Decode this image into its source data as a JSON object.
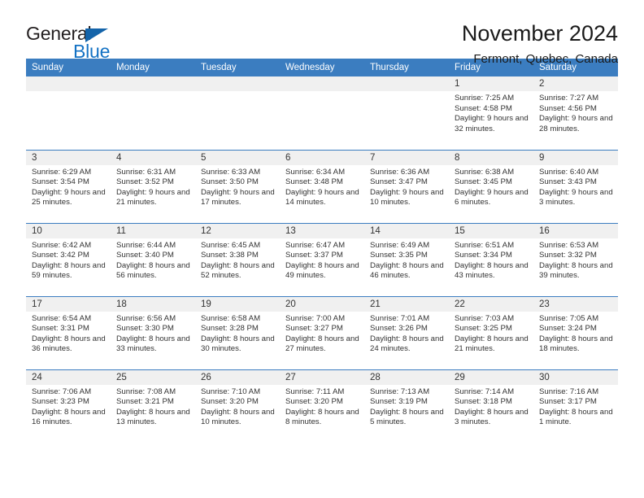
{
  "brand": {
    "word_one": "General",
    "word_two": "Blue",
    "triangle_icon": "triangle-icon",
    "accent_color": "#1472c4"
  },
  "header": {
    "title": "November 2024",
    "subtitle": "Fermont, Quebec, Canada"
  },
  "calendar": {
    "header_bg": "#3b7dc0",
    "daynum_bg": "#f0f0f0",
    "weekdays": [
      "Sunday",
      "Monday",
      "Tuesday",
      "Wednesday",
      "Thursday",
      "Friday",
      "Saturday"
    ],
    "weeks": [
      [
        {
          "day": "",
          "empty": true
        },
        {
          "day": "",
          "empty": true
        },
        {
          "day": "",
          "empty": true
        },
        {
          "day": "",
          "empty": true
        },
        {
          "day": "",
          "empty": true
        },
        {
          "day": "1",
          "sunrise": "Sunrise: 7:25 AM",
          "sunset": "Sunset: 4:58 PM",
          "daylight": "Daylight: 9 hours and 32 minutes."
        },
        {
          "day": "2",
          "sunrise": "Sunrise: 7:27 AM",
          "sunset": "Sunset: 4:56 PM",
          "daylight": "Daylight: 9 hours and 28 minutes."
        }
      ],
      [
        {
          "day": "3",
          "sunrise": "Sunrise: 6:29 AM",
          "sunset": "Sunset: 3:54 PM",
          "daylight": "Daylight: 9 hours and 25 minutes."
        },
        {
          "day": "4",
          "sunrise": "Sunrise: 6:31 AM",
          "sunset": "Sunset: 3:52 PM",
          "daylight": "Daylight: 9 hours and 21 minutes."
        },
        {
          "day": "5",
          "sunrise": "Sunrise: 6:33 AM",
          "sunset": "Sunset: 3:50 PM",
          "daylight": "Daylight: 9 hours and 17 minutes."
        },
        {
          "day": "6",
          "sunrise": "Sunrise: 6:34 AM",
          "sunset": "Sunset: 3:48 PM",
          "daylight": "Daylight: 9 hours and 14 minutes."
        },
        {
          "day": "7",
          "sunrise": "Sunrise: 6:36 AM",
          "sunset": "Sunset: 3:47 PM",
          "daylight": "Daylight: 9 hours and 10 minutes."
        },
        {
          "day": "8",
          "sunrise": "Sunrise: 6:38 AM",
          "sunset": "Sunset: 3:45 PM",
          "daylight": "Daylight: 9 hours and 6 minutes."
        },
        {
          "day": "9",
          "sunrise": "Sunrise: 6:40 AM",
          "sunset": "Sunset: 3:43 PM",
          "daylight": "Daylight: 9 hours and 3 minutes."
        }
      ],
      [
        {
          "day": "10",
          "sunrise": "Sunrise: 6:42 AM",
          "sunset": "Sunset: 3:42 PM",
          "daylight": "Daylight: 8 hours and 59 minutes."
        },
        {
          "day": "11",
          "sunrise": "Sunrise: 6:44 AM",
          "sunset": "Sunset: 3:40 PM",
          "daylight": "Daylight: 8 hours and 56 minutes."
        },
        {
          "day": "12",
          "sunrise": "Sunrise: 6:45 AM",
          "sunset": "Sunset: 3:38 PM",
          "daylight": "Daylight: 8 hours and 52 minutes."
        },
        {
          "day": "13",
          "sunrise": "Sunrise: 6:47 AM",
          "sunset": "Sunset: 3:37 PM",
          "daylight": "Daylight: 8 hours and 49 minutes."
        },
        {
          "day": "14",
          "sunrise": "Sunrise: 6:49 AM",
          "sunset": "Sunset: 3:35 PM",
          "daylight": "Daylight: 8 hours and 46 minutes."
        },
        {
          "day": "15",
          "sunrise": "Sunrise: 6:51 AM",
          "sunset": "Sunset: 3:34 PM",
          "daylight": "Daylight: 8 hours and 43 minutes."
        },
        {
          "day": "16",
          "sunrise": "Sunrise: 6:53 AM",
          "sunset": "Sunset: 3:32 PM",
          "daylight": "Daylight: 8 hours and 39 minutes."
        }
      ],
      [
        {
          "day": "17",
          "sunrise": "Sunrise: 6:54 AM",
          "sunset": "Sunset: 3:31 PM",
          "daylight": "Daylight: 8 hours and 36 minutes."
        },
        {
          "day": "18",
          "sunrise": "Sunrise: 6:56 AM",
          "sunset": "Sunset: 3:30 PM",
          "daylight": "Daylight: 8 hours and 33 minutes."
        },
        {
          "day": "19",
          "sunrise": "Sunrise: 6:58 AM",
          "sunset": "Sunset: 3:28 PM",
          "daylight": "Daylight: 8 hours and 30 minutes."
        },
        {
          "day": "20",
          "sunrise": "Sunrise: 7:00 AM",
          "sunset": "Sunset: 3:27 PM",
          "daylight": "Daylight: 8 hours and 27 minutes."
        },
        {
          "day": "21",
          "sunrise": "Sunrise: 7:01 AM",
          "sunset": "Sunset: 3:26 PM",
          "daylight": "Daylight: 8 hours and 24 minutes."
        },
        {
          "day": "22",
          "sunrise": "Sunrise: 7:03 AM",
          "sunset": "Sunset: 3:25 PM",
          "daylight": "Daylight: 8 hours and 21 minutes."
        },
        {
          "day": "23",
          "sunrise": "Sunrise: 7:05 AM",
          "sunset": "Sunset: 3:24 PM",
          "daylight": "Daylight: 8 hours and 18 minutes."
        }
      ],
      [
        {
          "day": "24",
          "sunrise": "Sunrise: 7:06 AM",
          "sunset": "Sunset: 3:23 PM",
          "daylight": "Daylight: 8 hours and 16 minutes."
        },
        {
          "day": "25",
          "sunrise": "Sunrise: 7:08 AM",
          "sunset": "Sunset: 3:21 PM",
          "daylight": "Daylight: 8 hours and 13 minutes."
        },
        {
          "day": "26",
          "sunrise": "Sunrise: 7:10 AM",
          "sunset": "Sunset: 3:20 PM",
          "daylight": "Daylight: 8 hours and 10 minutes."
        },
        {
          "day": "27",
          "sunrise": "Sunrise: 7:11 AM",
          "sunset": "Sunset: 3:20 PM",
          "daylight": "Daylight: 8 hours and 8 minutes."
        },
        {
          "day": "28",
          "sunrise": "Sunrise: 7:13 AM",
          "sunset": "Sunset: 3:19 PM",
          "daylight": "Daylight: 8 hours and 5 minutes."
        },
        {
          "day": "29",
          "sunrise": "Sunrise: 7:14 AM",
          "sunset": "Sunset: 3:18 PM",
          "daylight": "Daylight: 8 hours and 3 minutes."
        },
        {
          "day": "30",
          "sunrise": "Sunrise: 7:16 AM",
          "sunset": "Sunset: 3:17 PM",
          "daylight": "Daylight: 8 hours and 1 minute."
        }
      ]
    ]
  }
}
